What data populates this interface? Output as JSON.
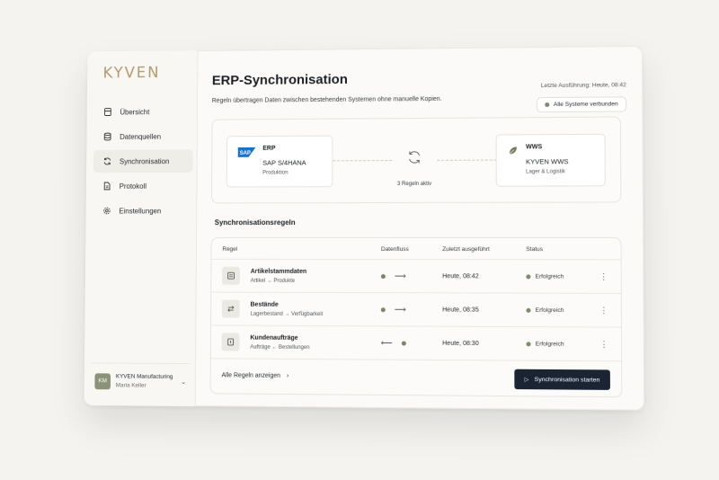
{
  "app": {
    "logo": "KYVEN"
  },
  "sidebar": {
    "items": [
      {
        "label": "Übersicht",
        "icon": "dashboard-icon"
      },
      {
        "label": "Datenquellen",
        "icon": "database-icon"
      },
      {
        "label": "Synchronisation",
        "icon": "sync-icon",
        "active": true
      },
      {
        "label": "Protokoll",
        "icon": "document-icon"
      },
      {
        "label": "Einstellungen",
        "icon": "gear-icon"
      }
    ],
    "user": {
      "initials": "KM",
      "company": "KYVEN Manufacturing",
      "name": "Maria Keller"
    }
  },
  "header": {
    "title": "ERP-Synchronisation",
    "subtitle": "Regeln übertragen Daten zwischen bestehenden Systemen ohne manuelle Kopien.",
    "last_run": "Letzte Ausführung: Heute, 08:42",
    "status": "Alle Systeme verbunden"
  },
  "flow": {
    "source": {
      "logo": "SAP",
      "name": "ERP",
      "product": "SAP S/4HANA",
      "desc": "Produktion"
    },
    "target": {
      "name": "WWS",
      "product": "KYVEN WWS",
      "desc": "Lager & Logistik"
    },
    "rules_active": "3 Regeln aktiv"
  },
  "rules": {
    "heading": "Synchronisationsregeln",
    "columns": [
      "Regel",
      "Datenfluss",
      "Zuletzt ausgeführt",
      "Status"
    ],
    "rows": [
      {
        "title": "Artikelstammdaten",
        "mapping": "Artikel → Produkte",
        "direction": "right",
        "time": "Heute, 08:42",
        "status": "Erfolgreich"
      },
      {
        "title": "Bestände",
        "mapping": "Lagerbestand → Verfügbarkeit",
        "direction": "right",
        "time": "Heute, 08:35",
        "status": "Erfolgreich"
      },
      {
        "title": "Kundenaufträge",
        "mapping": "Aufträge ← Bestellungen",
        "direction": "left",
        "time": "Heute, 08:30",
        "status": "Erfolgreich"
      }
    ],
    "show_all": "Alle Regeln anzeigen",
    "start_button": "Synchronisation starten"
  },
  "colors": {
    "accent": "#b39a6e",
    "primary_button": "#1b2433",
    "success": "#7e8c6a"
  }
}
